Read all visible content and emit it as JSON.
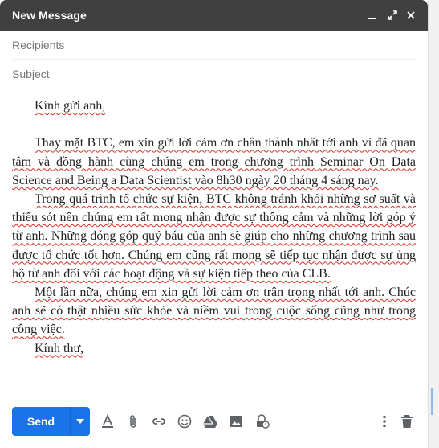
{
  "window": {
    "title": "New Message",
    "controls": [
      "minimize-icon",
      "expand-icon",
      "close-icon"
    ]
  },
  "fields": {
    "recipients_placeholder": "Recipients",
    "subject_placeholder": "Subject"
  },
  "body": {
    "greeting": "Kính gửi anh,",
    "paragraphs": [
      "Thay mặt BTC, em xin gửi lời cảm ơn chân thành nhất tới anh vì đã quan tâm và đồng hành cùng chúng em trong chương trình Seminar On Data Science and Being a Data Scientist vào 8h30 ngày 20 tháng 4 sáng nay.",
      "Trong quá trình tổ chức sự kiện, BTC không tránh khỏi những sơ suất và thiếu sót nên chúng em rất mong nhận được sự thông cảm và những lời góp ý từ anh. Những đóng góp quý báu của anh sẽ giúp cho những chương trình sau được tổ chức tốt hơn. Chúng em cũng rất mong sẽ tiếp tục nhận được sự ủng hộ từ anh đối với các hoạt động và sự kiện tiếp theo của CLB.",
      "Một lần nữa, chúng em xin gửi lời cảm ơn trân trọng nhất tới anh. Chúc anh sẽ có thật nhiều sức khỏe và niềm vui trong cuộc sống cũng như trong công việc."
    ],
    "closing": "Kính thư,"
  },
  "toolbar": {
    "send_label": "Send",
    "send_options_icon": "caret-down-icon",
    "tools": [
      "text-format-icon",
      "attach-icon",
      "link-icon",
      "emoji-icon",
      "drive-icon",
      "photo-icon",
      "confidential-icon"
    ],
    "right_tools": [
      "more-options-icon",
      "trash-icon"
    ]
  },
  "colors": {
    "titlebar": "#404040",
    "send": "#1a73e8",
    "spellcheck": "#d93025"
  }
}
